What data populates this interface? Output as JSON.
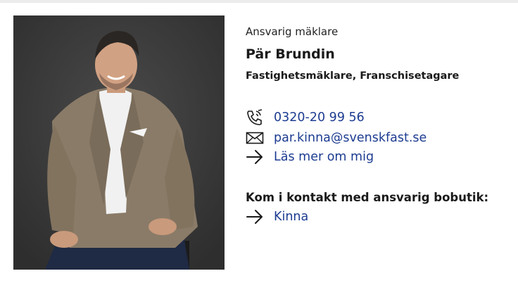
{
  "agent": {
    "role_label": "Ansvarig mäklare",
    "name": "Pär Brundin",
    "title": "Fastighetsmäklare, Franschisetagare",
    "photo_alt": "photo of Pär Brundin"
  },
  "contact": {
    "phone": "0320-20 99 56",
    "phone_icon": "phone-icon",
    "email": "par.kinna@svenskfast.se",
    "email_icon": "envelope-icon",
    "read_more": "Läs mer om mig",
    "read_more_icon": "arrow-right-icon"
  },
  "shop": {
    "heading": "Kom i kontakt med ansvarig bobutik:",
    "name": "Kinna",
    "icon": "arrow-right-icon"
  },
  "colors": {
    "link": "#1d3c91",
    "text": "#1a1a1a",
    "photo_background": "#3b3b3b"
  }
}
